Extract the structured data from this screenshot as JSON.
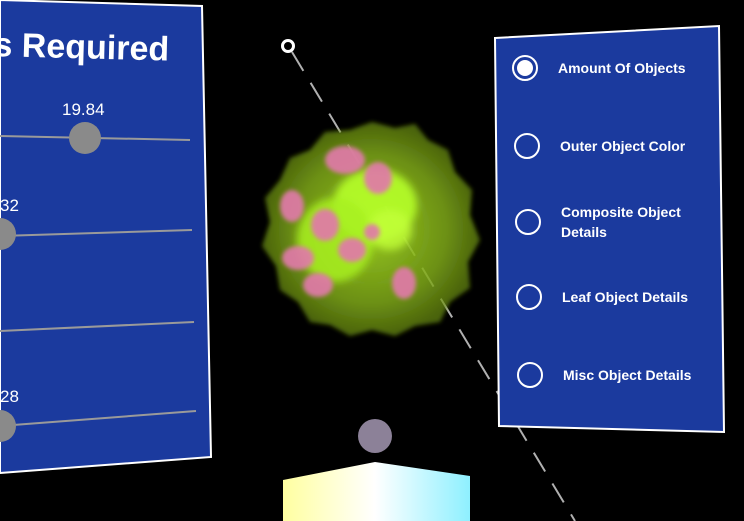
{
  "left_panel": {
    "title": "s Required",
    "slider_1_value": "19.84",
    "slider_2_value": "32",
    "slider_3_value": "28"
  },
  "right_panel": {
    "menu_items": [
      {
        "label": "Amount Of Objects",
        "selected": true
      },
      {
        "label": "Outer Object Color",
        "selected": false
      },
      {
        "label": "Composite Object Details",
        "selected": false
      },
      {
        "label": "Leaf Object Details",
        "selected": false
      },
      {
        "label": "Misc Object Details",
        "selected": false
      }
    ]
  },
  "colors": {
    "panel_blue": "#1b3a9e",
    "panel_border": "#ffffff",
    "slider_track": "#9a9a9a",
    "slider_thumb": "#8a8a8a",
    "object_outer": "#8fbf1a",
    "object_inner": "#b6ff2a",
    "object_leaf": "#e07aa8",
    "cursor": "#8c8198"
  },
  "icons": {
    "pointer": "ring-pointer-icon",
    "radio": "radio-button-icon"
  }
}
